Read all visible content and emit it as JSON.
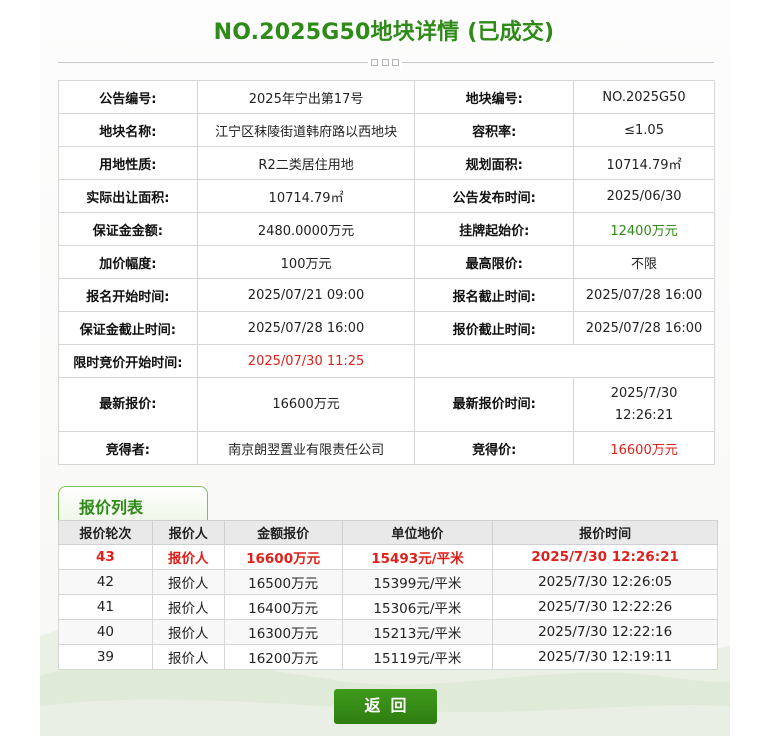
{
  "title": "NO.2025G50地块详情 (已成交)",
  "detail": {
    "rows": [
      [
        {
          "label": "公告编号:",
          "value": "2025年宁出第17号"
        },
        {
          "label": "地块编号:",
          "value": "NO.2025G50"
        }
      ],
      [
        {
          "label": "地块名称:",
          "value": "江宁区秣陵街道韩府路以西地块"
        },
        {
          "label": "容积率:",
          "value": "≤1.05"
        }
      ],
      [
        {
          "label": "用地性质:",
          "value": "R2二类居住用地"
        },
        {
          "label": "规划面积:",
          "value": "10714.79㎡"
        }
      ],
      [
        {
          "label": "实际出让面积:",
          "value": "10714.79㎡"
        },
        {
          "label": "公告发布时间:",
          "value": "2025/06/30"
        }
      ],
      [
        {
          "label": "保证金金额:",
          "value": "2480.0000万元"
        },
        {
          "label": "挂牌起始价:",
          "value": "12400万元"
        }
      ],
      [
        {
          "label": "加价幅度:",
          "value": "100万元"
        },
        {
          "label": "最高限价:",
          "value": "不限"
        }
      ],
      [
        {
          "label": "报名开始时间:",
          "value": "2025/07/21 09:00"
        },
        {
          "label": "报名截止时间:",
          "value": "2025/07/28 16:00"
        }
      ],
      [
        {
          "label": "保证金截止时间:",
          "value": "2025/07/28 16:00"
        },
        {
          "label": "报价截止时间:",
          "value": "2025/07/28 16:00"
        }
      ]
    ],
    "auction_start": {
      "label": "限时竞价开始时间:",
      "value": "2025/07/30 11:25"
    },
    "latest_bid": {
      "label": "最新报价:",
      "value": "16600万元"
    },
    "latest_bid_time": {
      "label": "最新报价时间:",
      "value_line1": "2025/7/30",
      "value_line2": "12:26:21"
    },
    "winner": {
      "label": "竞得者:",
      "value": "南京朗翌置业有限责任公司"
    },
    "winning_price": {
      "label": "竞得价:",
      "value": "16600万元"
    }
  },
  "bid_list": {
    "heading": "报价列表",
    "headers": [
      "报价轮次",
      "报价人",
      "金额报价",
      "单位地价",
      "报价时间"
    ],
    "rows": [
      [
        "43",
        "报价人",
        "16600万元",
        "15493元/平米",
        "2025/7/30 12:26:21"
      ],
      [
        "42",
        "报价人",
        "16500万元",
        "15399元/平米",
        "2025/7/30 12:26:05"
      ],
      [
        "41",
        "报价人",
        "16400万元",
        "15306元/平米",
        "2025/7/30 12:22:26"
      ],
      [
        "40",
        "报价人",
        "16300万元",
        "15213元/平米",
        "2025/7/30 12:22:16"
      ],
      [
        "39",
        "报价人",
        "16200万元",
        "15119元/平米",
        "2025/7/30 12:19:11"
      ]
    ]
  },
  "back_button": "返回",
  "colors": {
    "brand_green": "#2e8b17",
    "highlight_red": "#e0201b"
  }
}
